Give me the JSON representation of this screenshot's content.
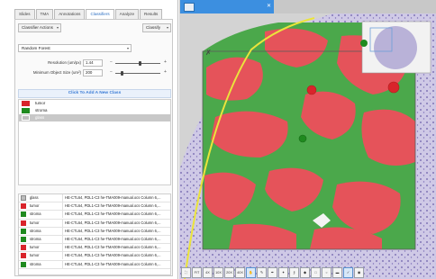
{
  "tabs": [
    {
      "label": "Slides"
    },
    {
      "label": "TMA"
    },
    {
      "label": "Annotations"
    },
    {
      "label": "Classifiers",
      "active": true
    },
    {
      "label": "Analyze"
    },
    {
      "label": "Results"
    }
  ],
  "classifier_actions_label": "Classifier Actions",
  "classify_label": "Classify",
  "classifier_type": "Random Forest",
  "params": [
    {
      "label": "Resolution (um/px)",
      "value": "1.44",
      "slider_fraction": 0.55
    },
    {
      "label": "Minimum Object Size (um²)",
      "value": "200",
      "slider_fraction": 0.12
    }
  ],
  "add_class_label": "Click To Add A New Class",
  "classes": [
    {
      "name": "tumor",
      "color": "#d9242b"
    },
    {
      "name": "stroma",
      "color": "#1f8a1f"
    },
    {
      "name": "glass",
      "color": "#bdbdbd",
      "selected": true
    }
  ],
  "annotations": [
    {
      "class": "glass",
      "color": "#bdbdbd",
      "desc": "HE-CTL64, PDL1-C3 he-TMA009-manual.ocs Column 6,..."
    },
    {
      "class": "tumor",
      "color": "#d9242b",
      "desc": "HE-CTL64, PDL1-C3 he-TMA009-manual.ocs Column 6,..."
    },
    {
      "class": "stroma",
      "color": "#1f8a1f",
      "desc": "HE-CTL64, PDL1-C3 he-TMA009-manual.ocs Column 6,..."
    },
    {
      "class": "tumor",
      "color": "#d9242b",
      "desc": "HE-CTL64, PDL1-C3 he-TMA009-manual.ocs Column 6,..."
    },
    {
      "class": "stroma",
      "color": "#1f8a1f",
      "desc": "HE-CTL64, PDL1-C3 he-TMA009-manual.ocs Column 6,..."
    },
    {
      "class": "stroma",
      "color": "#1f8a1f",
      "desc": "HE-CTL64, PDL1-C3 he-TMA009-manual.ocs Column 6,..."
    },
    {
      "class": "tumor",
      "color": "#d9242b",
      "desc": "HE-CTL64, PDL1-C3 he-TMA009-manual.ocs Column 6,..."
    },
    {
      "class": "tumor",
      "color": "#d9242b",
      "desc": "HE-CTL64, PDL1-C3 he-TMA009-manual.ocs Column 6,..."
    },
    {
      "class": "stroma",
      "color": "#1f8a1f",
      "desc": "HE-CTL64, PDL1-C3 he-TMA009-manual.ocs Column 6,..."
    }
  ],
  "toolbar": {
    "items": [
      {
        "name": "fit-icon",
        "label": ""
      },
      {
        "name": "zoom-fit",
        "label": "FIT"
      },
      {
        "name": "zoom-4x",
        "label": "4X"
      },
      {
        "name": "zoom-10x",
        "label": "10X"
      },
      {
        "name": "zoom-20x",
        "label": "20X"
      },
      {
        "name": "zoom-40x",
        "label": "40X"
      },
      {
        "name": "hand-tool-icon",
        "label": "",
        "highlight": true
      },
      {
        "name": "brush-icon",
        "label": ""
      },
      {
        "name": "pen-icon",
        "label": ""
      },
      {
        "name": "wand-icon",
        "label": ""
      },
      {
        "name": "lasso-icon",
        "label": ""
      },
      {
        "name": "diamond-icon",
        "label": ""
      },
      {
        "name": "rectangle-icon",
        "label": ""
      },
      {
        "name": "ellipse-icon",
        "label": ""
      },
      {
        "name": "line-icon",
        "label": ""
      },
      {
        "name": "checkmark-icon",
        "label": "",
        "highlight": true
      },
      {
        "name": "camera-icon",
        "label": ""
      }
    ]
  },
  "colors": {
    "tumor_overlay": "#e5535a",
    "stroma_overlay": "#4ba84b",
    "tissue": "#cfc9e6",
    "annotation_outline": "#ebe43c",
    "window_tab": "#3c8fe0"
  }
}
